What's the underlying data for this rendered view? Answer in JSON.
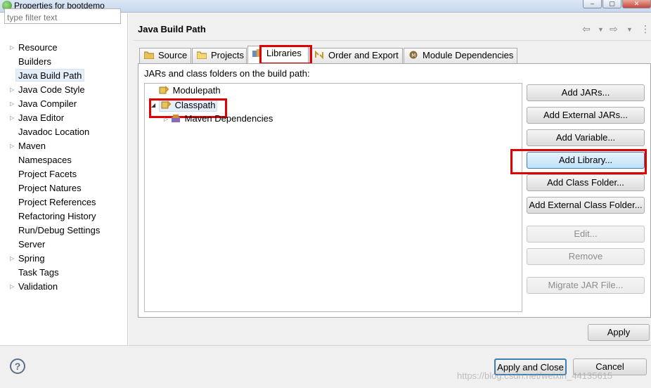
{
  "window": {
    "title": "Properties for bootdemo",
    "controls": [
      "–",
      "▢",
      "✕"
    ]
  },
  "filter": {
    "placeholder": "type filter text"
  },
  "nav": {
    "items": [
      {
        "label": "Resource",
        "expandable": true
      },
      {
        "label": "Builders",
        "expandable": false
      },
      {
        "label": "Java Build Path",
        "expandable": false,
        "selected": true
      },
      {
        "label": "Java Code Style",
        "expandable": true
      },
      {
        "label": "Java Compiler",
        "expandable": true
      },
      {
        "label": "Java Editor",
        "expandable": true
      },
      {
        "label": "Javadoc Location",
        "expandable": false
      },
      {
        "label": "Maven",
        "expandable": true
      },
      {
        "label": "Namespaces",
        "expandable": false
      },
      {
        "label": "Project Facets",
        "expandable": false
      },
      {
        "label": "Project Natures",
        "expandable": false
      },
      {
        "label": "Project References",
        "expandable": false
      },
      {
        "label": "Refactoring History",
        "expandable": false
      },
      {
        "label": "Run/Debug Settings",
        "expandable": false
      },
      {
        "label": "Server",
        "expandable": false
      },
      {
        "label": "Spring",
        "expandable": true
      },
      {
        "label": "Task Tags",
        "expandable": false
      },
      {
        "label": "Validation",
        "expandable": true
      }
    ]
  },
  "page": {
    "title": "Java Build Path",
    "nav_icons": [
      "back-arrow-icon",
      "dropdown-icon",
      "forward-arrow-icon",
      "dropdown-icon",
      "more-icon"
    ]
  },
  "tabs": [
    {
      "label": "Source",
      "icon": "source-folder-icon"
    },
    {
      "label": "Projects",
      "icon": "projects-folder-icon"
    },
    {
      "label": "Libraries",
      "icon": "libraries-icon",
      "active": true
    },
    {
      "label": "Order and Export",
      "icon": "order-export-icon"
    },
    {
      "label": "Module Dependencies",
      "icon": "module-icon"
    }
  ],
  "libraries": {
    "description": "JARs and class folders on the build path:",
    "tree": [
      {
        "label": "Modulepath",
        "expanded": false
      },
      {
        "label": "Classpath",
        "expanded": true,
        "selected": true
      },
      {
        "label": "Maven Dependencies",
        "child": true
      }
    ]
  },
  "buttons": {
    "add_jars": "Add JARs...",
    "add_external_jars": "Add External JARs...",
    "add_variable": "Add Variable...",
    "add_library": "Add Library...",
    "add_class_folder": "Add Class Folder...",
    "add_external_class_folder": "Add External Class Folder...",
    "edit": "Edit...",
    "remove": "Remove",
    "migrate_jar": "Migrate JAR File...",
    "apply": "Apply",
    "apply_and_close": "Apply and Close",
    "cancel": "Cancel"
  },
  "watermark": "https://blog.csdn.net/weixin_44135615",
  "colors": {
    "highlight": "#e00000",
    "selection": "#e5effa",
    "hot_button": "#bfe1f8"
  }
}
